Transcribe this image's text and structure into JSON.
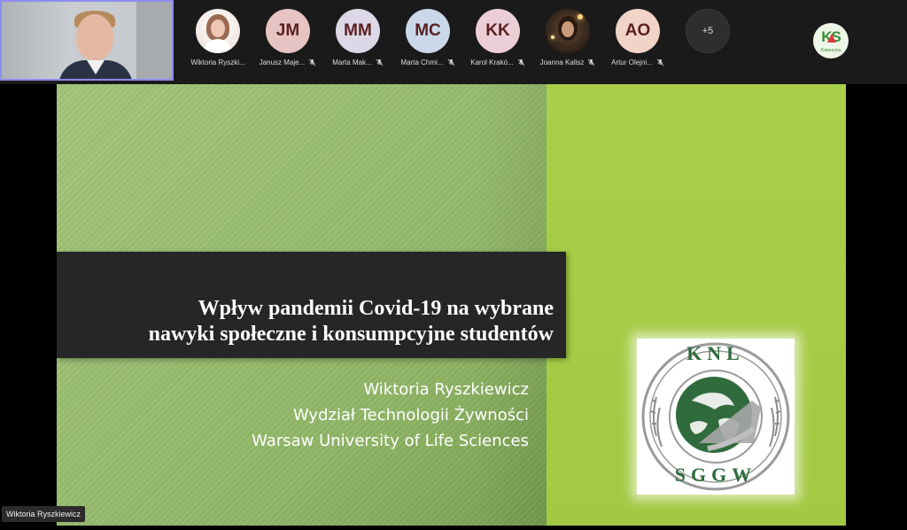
{
  "meeting": {
    "self_view": {
      "name": "Wiktoria Ryszkiewicz"
    },
    "participants": [
      {
        "name": "Wiktoria Ryszki...",
        "initials": "",
        "avatar": "photo",
        "muted": false,
        "avatar_bg": "#f4eae6"
      },
      {
        "name": "Janusz Maje...",
        "initials": "JM",
        "avatar": "initials",
        "muted": true,
        "avatar_bg": "#e6c4c4"
      },
      {
        "name": "Marta Mak...",
        "initials": "MM",
        "avatar": "initials",
        "muted": true,
        "avatar_bg": "#dcd8e8"
      },
      {
        "name": "Marta Chmi...",
        "initials": "MC",
        "avatar": "initials",
        "muted": true,
        "avatar_bg": "#cbd8ea"
      },
      {
        "name": "Karol Krakó...",
        "initials": "KK",
        "avatar": "initials",
        "muted": true,
        "avatar_bg": "#eccfd6"
      },
      {
        "name": "Joanna Kalisz",
        "initials": "",
        "avatar": "photo",
        "muted": true,
        "avatar_bg": "#3a2a1e"
      },
      {
        "name": "Artur Olejni...",
        "initials": "AO",
        "avatar": "initials",
        "muted": true,
        "avatar_bg": "#f0d4c8"
      }
    ],
    "more_count": "+5",
    "ks_avatar": {
      "letters": "KS",
      "caption": "Katarzyna"
    },
    "speaker_label": "Wiktoria Ryszkiewicz"
  },
  "slide": {
    "title_line1": "Wpływ pandemii Covid-19 na wybrane",
    "title_line2": "nawyki społeczne i konsumpcyjne studentów",
    "subtitle_lines": [
      "Wiktoria Ryszkiewicz",
      "Wydział Technologii Żywności",
      "Warsaw University of Life Sciences"
    ],
    "logo": {
      "top_text": "KNL",
      "bottom_text": "SGGW"
    }
  },
  "colors": {
    "initials_text": "#5a2020",
    "slide_green_light": "#a2c57a",
    "slide_green_right": "#a9cf4a",
    "title_bar": "#262626",
    "logo_green": "#2f6b3c",
    "self_border": "#8c8cf0"
  }
}
